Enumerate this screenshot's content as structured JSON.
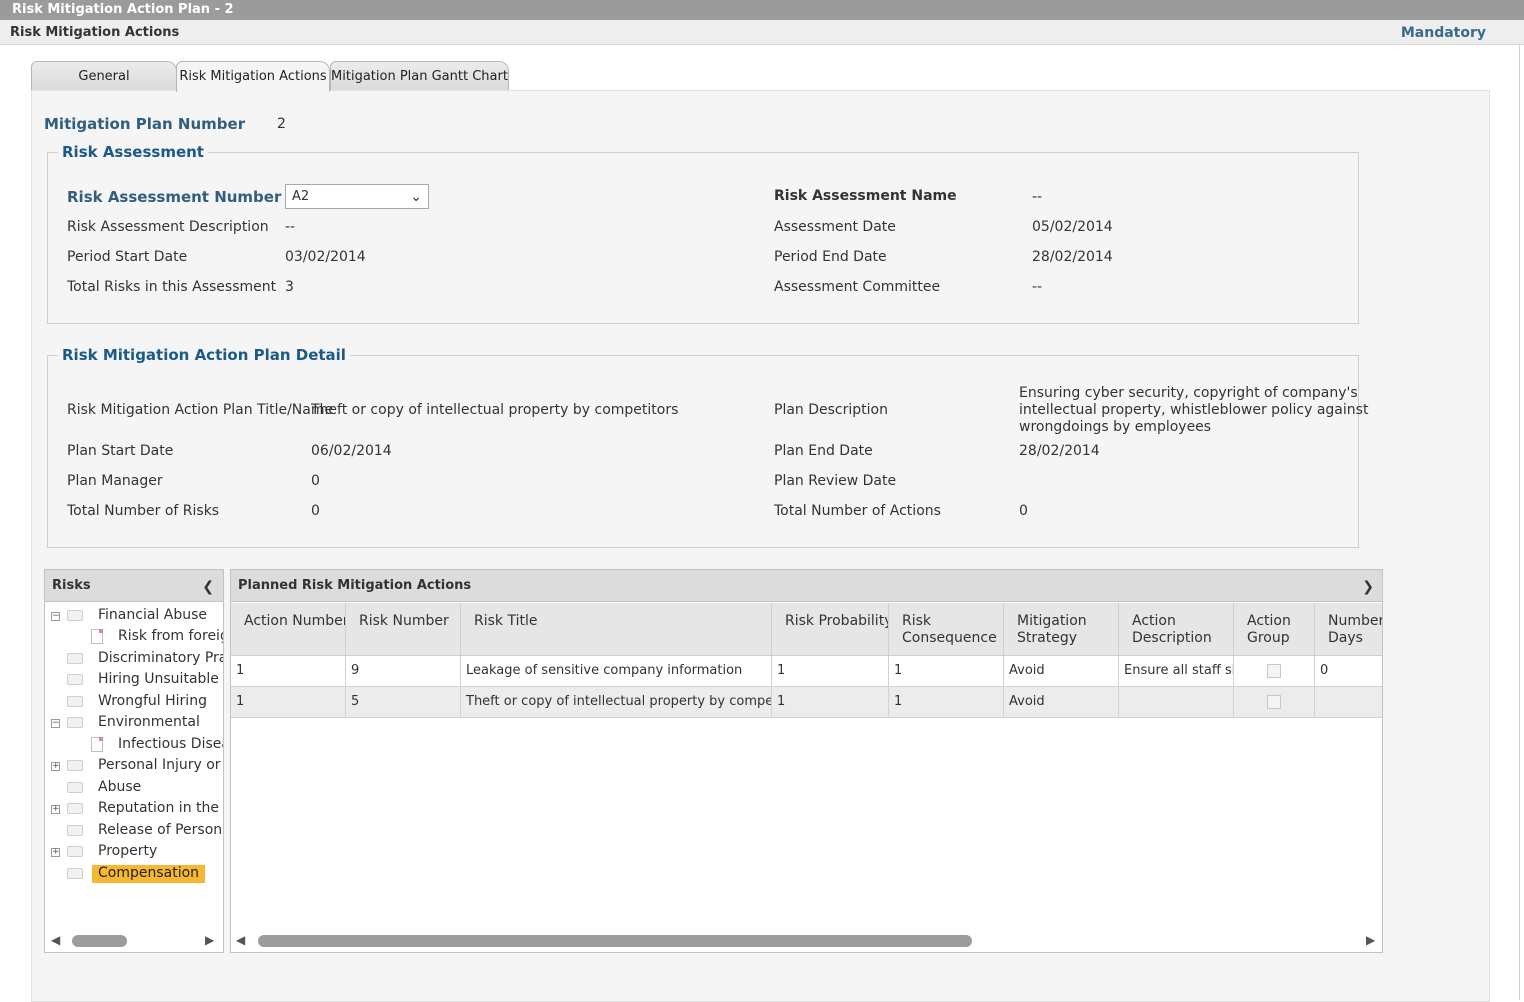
{
  "window": {
    "title": "Risk Mitigation Action Plan  - 2"
  },
  "header": {
    "title": "Risk Mitigation Actions",
    "mandatory": "Mandatory"
  },
  "tabs": [
    {
      "label": "General",
      "active": false
    },
    {
      "label": "Risk Mitigation Actions",
      "active": true
    },
    {
      "label": "Mitigation Plan Gantt Chart",
      "active": false
    }
  ],
  "plan_number": {
    "label": "Mitigation Plan Number",
    "value": "2"
  },
  "risk_assessment": {
    "legend": "Risk Assessment",
    "number_label": "Risk Assessment Number",
    "number_value": "A2",
    "name_label": "Risk Assessment Name",
    "name_value": "--",
    "desc_label": "Risk Assessment Description",
    "desc_value": "--",
    "assess_date_label": "Assessment Date",
    "assess_date_value": "05/02/2014",
    "start_label": "Period Start Date",
    "start_value": "03/02/2014",
    "end_label": "Period End Date",
    "end_value": "28/02/2014",
    "total_label": "Total Risks in this Assessment",
    "total_value": "3",
    "committee_label": "Assessment Committee",
    "committee_value": "--"
  },
  "plan_detail": {
    "legend": "Risk Mitigation Action Plan Detail",
    "title_label": "Risk Mitigation Action Plan Title/Name",
    "title_value": "Theft or copy of intellectual property by competitors",
    "desc_label": "Plan Description",
    "desc_value_1": "Ensuring cyber security, copyright of company's",
    "desc_value_2": "intellectual property, whistleblower policy against",
    "desc_value_3": "wrongdoings by employees",
    "start_label": "Plan Start Date",
    "start_value": "06/02/2014",
    "end_label": "Plan End Date",
    "end_value": "28/02/2014",
    "manager_label": "Plan Manager",
    "manager_value": "0",
    "review_label": "Plan Review Date",
    "review_value": "",
    "risks_label": "Total Number of Risks",
    "risks_value": "0",
    "actions_label": "Total Number of Actions",
    "actions_value": "0"
  },
  "risks_panel": {
    "title": "Risks",
    "items": [
      {
        "label": "Financial Abuse",
        "kind": "folder",
        "expander": "minus"
      },
      {
        "label": "Risk from foreign",
        "kind": "doc",
        "expander": ""
      },
      {
        "label": "Discriminatory Pract",
        "kind": "folder",
        "expander": ""
      },
      {
        "label": "Hiring Unsuitable or",
        "kind": "folder",
        "expander": ""
      },
      {
        "label": "Wrongful Hiring",
        "kind": "folder",
        "expander": ""
      },
      {
        "label": "Environmental",
        "kind": "folder",
        "expander": "minus"
      },
      {
        "label": "Infectious Diseas",
        "kind": "doc",
        "expander": ""
      },
      {
        "label": "Personal Injury or D",
        "kind": "folder",
        "expander": "plus"
      },
      {
        "label": "Abuse",
        "kind": "folder",
        "expander": ""
      },
      {
        "label": "Reputation in the Co",
        "kind": "folder",
        "expander": "plus"
      },
      {
        "label": "Release of Personal",
        "kind": "folder",
        "expander": ""
      },
      {
        "label": "Property",
        "kind": "folder",
        "expander": "plus"
      },
      {
        "label": "Compensation",
        "kind": "folder",
        "expander": "",
        "selected": true
      }
    ]
  },
  "actions_panel": {
    "title": "Planned Risk Mitigation Actions",
    "columns": [
      {
        "l1": "Action Number",
        "l2": ""
      },
      {
        "l1": "Risk Number",
        "l2": ""
      },
      {
        "l1": "Risk Title",
        "l2": ""
      },
      {
        "l1": "Risk Probability",
        "l2": ""
      },
      {
        "l1": "Risk",
        "l2": "Consequence"
      },
      {
        "l1": "Mitigation",
        "l2": "Strategy"
      },
      {
        "l1": "Action",
        "l2": "Description"
      },
      {
        "l1": "Action",
        "l2": "Group"
      },
      {
        "l1": "Number",
        "l2": "Days"
      }
    ],
    "rows": [
      [
        "1",
        "9",
        "Leakage of sensitive company information",
        "1",
        "1",
        "Avoid",
        "Ensure all staff sign",
        "",
        "0"
      ],
      [
        "1",
        "5",
        "Theft or copy of intellectual property by competitors",
        "1",
        "1",
        "Avoid",
        "",
        "",
        ""
      ]
    ]
  },
  "colors": {
    "title_bar": "#9b9b9b",
    "label_blue": "#2f5e7e",
    "legend_blue": "#1b5a86",
    "selected": "#f7b731"
  }
}
